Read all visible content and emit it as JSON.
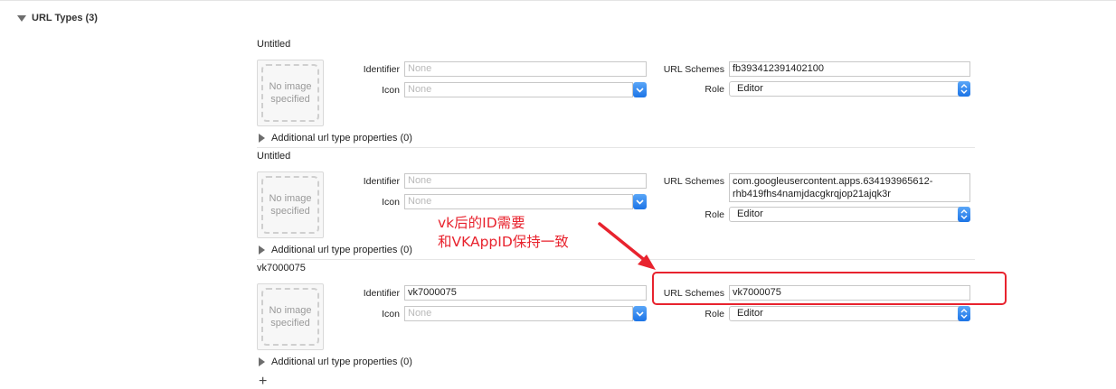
{
  "section": {
    "title": "URL Types (3)"
  },
  "image_well": {
    "placeholder": "No image specified"
  },
  "labels": {
    "identifier": "Identifier",
    "icon": "Icon",
    "url_schemes": "URL Schemes",
    "role": "Role"
  },
  "entries": [
    {
      "title": "Untitled",
      "identifier": "",
      "identifier_placeholder": "None",
      "icon": "",
      "icon_placeholder": "None",
      "url_schemes": "fb393412391402100",
      "role": "Editor",
      "additional": "Additional url type properties (0)"
    },
    {
      "title": "Untitled",
      "identifier": "",
      "identifier_placeholder": "None",
      "icon": "",
      "icon_placeholder": "None",
      "url_schemes": "com.googleusercontent.apps.634193965612-rhb419fhs4namjdacgkrqjop21ajqk3r",
      "role": "Editor",
      "additional": "Additional url type properties (0)"
    },
    {
      "title": "vk7000075",
      "identifier": "vk7000075",
      "identifier_placeholder": "None",
      "icon": "",
      "icon_placeholder": "None",
      "url_schemes": "vk7000075",
      "role": "Editor",
      "additional": "Additional url type properties (0)"
    }
  ],
  "add_button": "+",
  "annotation": {
    "line1": "vk后的ID需要",
    "line2": "和VKAppID保持一致",
    "color": "#e8232e"
  },
  "icons": {
    "disclosure": "triangle-disclosure-icon",
    "combo": "chevron-down-icon",
    "popup": "updown-chevrons-icon"
  }
}
